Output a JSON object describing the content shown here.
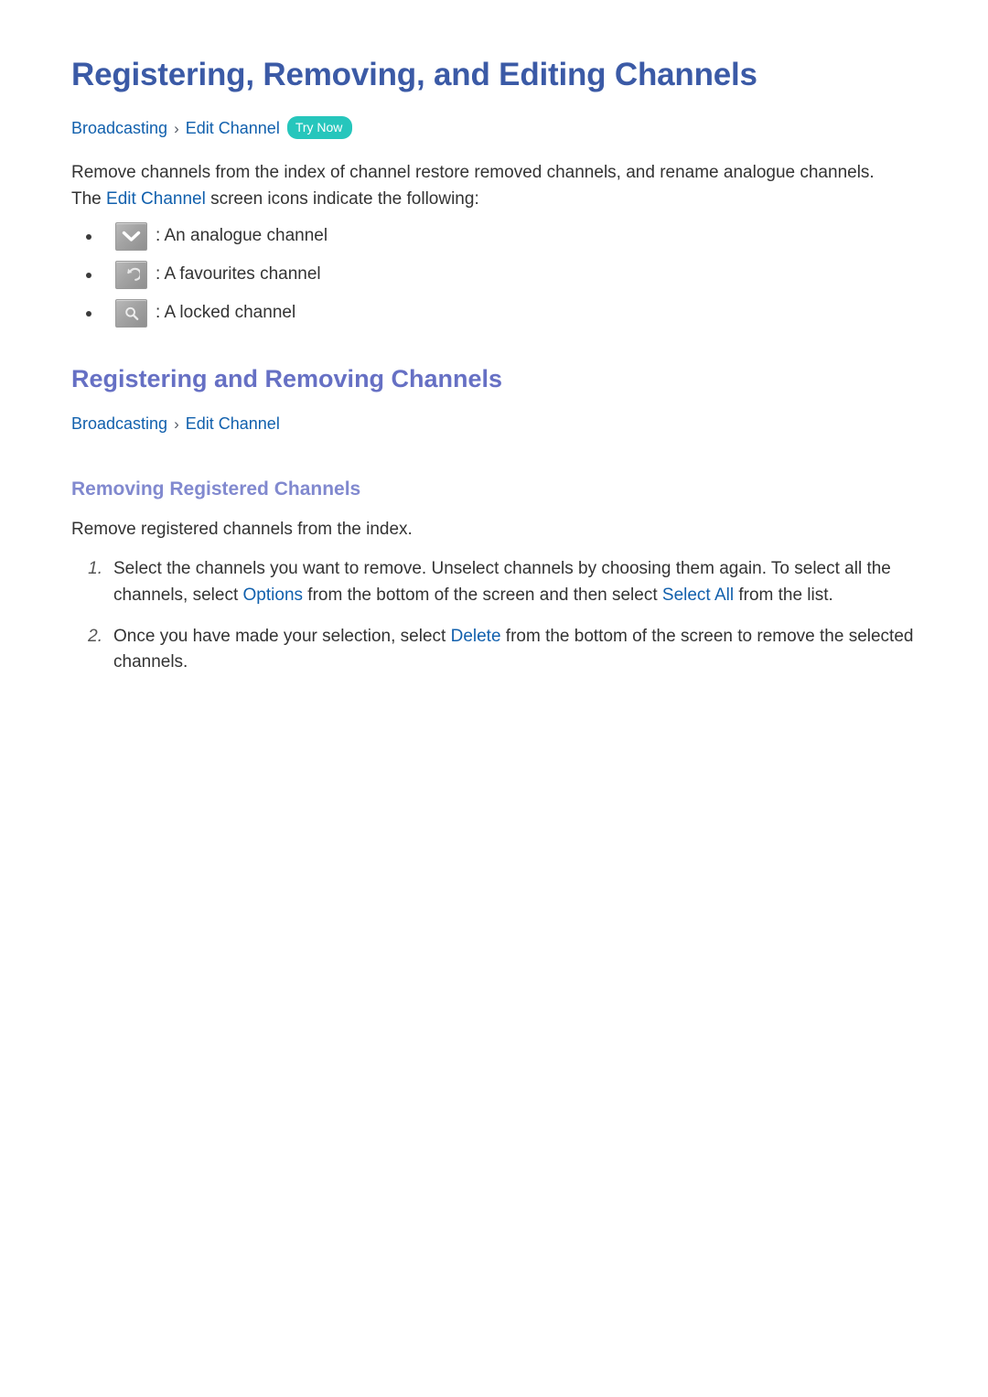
{
  "document": {
    "title": "Registering, Removing, and Editing Channels"
  },
  "breadcrumb_top": {
    "crumb1": "Broadcasting",
    "separator": "›",
    "crumb2": "Edit Channel",
    "badge": "Try Now"
  },
  "intro": {
    "line1_before": "Remove channels from the index of channel restore removed channels, and rename analogue channels.",
    "line2_before": "The ",
    "line2_link": "Edit Channel",
    "line2_after": " screen icons indicate the following:"
  },
  "icon_list": [
    {
      "icon": "chevron-down-icon",
      "caption": ": An analogue channel"
    },
    {
      "icon": "undo-arrow-icon",
      "caption": ": A favourites channel"
    },
    {
      "icon": "lock-magnifier-icon",
      "caption": ": A locked channel"
    }
  ],
  "section": {
    "heading": "Registering and Removing Channels",
    "breadcrumb": {
      "crumb1": "Broadcasting",
      "separator": "›",
      "crumb2": "Edit Channel"
    },
    "subheading": "Removing Registered Channels",
    "subintro": "Remove registered channels from the index."
  },
  "steps": [
    {
      "marker": "1.",
      "part1": "Select the channels you want to remove. Unselect channels by choosing them again. To select all the channels, select ",
      "link1": "Options",
      "part2": " from the bottom of the screen and then select ",
      "link2": "Select All",
      "part3": " from the list."
    },
    {
      "marker": "2.",
      "part1": "Once you have made your selection, select ",
      "link1": "Delete",
      "part2": " from the bottom of the screen to remove the selected channels.",
      "link2": "",
      "part3": ""
    }
  ],
  "colors": {
    "h1": "#3b5aa6",
    "h2": "#6670c4",
    "h3": "#8189cf",
    "link": "#1160ad",
    "badge": "#26c6bc",
    "body": "#333333"
  }
}
